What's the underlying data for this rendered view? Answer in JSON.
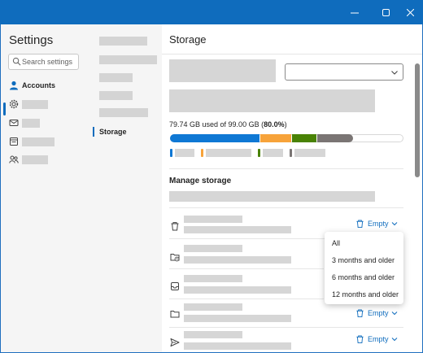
{
  "window": {
    "minimize_icon": "minimize-icon",
    "maximize_icon": "maximize-icon",
    "close_icon": "close-icon",
    "accent": "#0f6cbd"
  },
  "nav": {
    "title": "Settings",
    "search_placeholder": "Search settings",
    "items": [
      {
        "label": "Accounts",
        "icon": "person-icon"
      },
      {
        "label": "",
        "icon": "gear-icon"
      },
      {
        "label": "",
        "icon": "mail-icon"
      },
      {
        "label": "",
        "icon": "calendar-icon"
      },
      {
        "label": "",
        "icon": "people-icon"
      }
    ]
  },
  "subnav": {
    "active_label": "Storage"
  },
  "main": {
    "title": "Storage",
    "usage_prefix": "79.74 GB used of 99.00 GB (",
    "usage_percent": "80.0%",
    "usage_suffix": ")",
    "usage_fraction": 0.8,
    "segment_colors": [
      "#0f78d4",
      "#f7a33a",
      "#498205",
      "#7a7574"
    ],
    "manage_title": "Manage storage",
    "empty_label": "Empty",
    "rows": [
      {
        "icon": "trash-icon"
      },
      {
        "icon": "folder-clock-icon"
      },
      {
        "icon": "inbox-icon"
      },
      {
        "icon": "folder-icon"
      },
      {
        "icon": "send-icon"
      }
    ]
  },
  "menu": {
    "options": [
      "All",
      "3 months and older",
      "6 months and older",
      "12 months and older"
    ]
  }
}
